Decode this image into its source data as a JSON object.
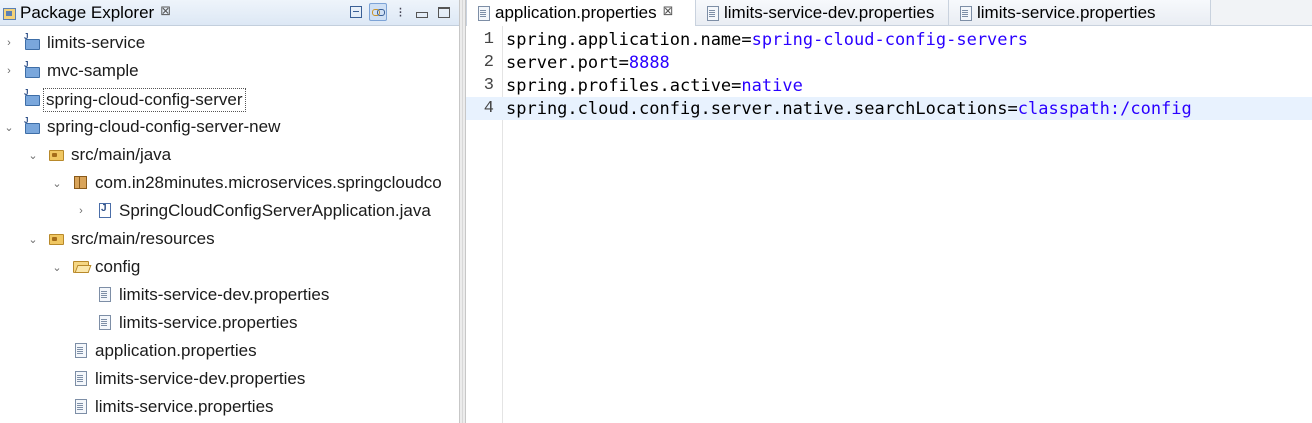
{
  "explorer": {
    "title": "Package Explorer",
    "close_glyph": "⊠",
    "toolbar": {
      "collapse_all": "collapse-all-icon",
      "link_editor": "link-with-editor-icon",
      "view_menu": "⁝",
      "minimize": "minimize-icon",
      "maximize": "maximize-icon"
    },
    "tree": [
      {
        "label": "limits-service",
        "depth": 0,
        "chevron": "›",
        "icon": "project"
      },
      {
        "label": "mvc-sample",
        "depth": 0,
        "chevron": "›",
        "icon": "project"
      },
      {
        "label": "spring-cloud-config-server",
        "depth": 0,
        "chevron": "",
        "icon": "project",
        "selected": true
      },
      {
        "label": "spring-cloud-config-server-new",
        "depth": 0,
        "chevron": "⌄",
        "icon": "project"
      },
      {
        "label": "src/main/java",
        "depth": 1,
        "chevron": "⌄",
        "icon": "srcfolder"
      },
      {
        "label": "com.in28minutes.microservices.springcloudco",
        "depth": 2,
        "chevron": "⌄",
        "icon": "package"
      },
      {
        "label": "SpringCloudConfigServerApplication.java",
        "depth": 3,
        "chevron": "›",
        "icon": "java"
      },
      {
        "label": "src/main/resources",
        "depth": 1,
        "chevron": "⌄",
        "icon": "srcfolder"
      },
      {
        "label": "config",
        "depth": 2,
        "chevron": "⌄",
        "icon": "folder"
      },
      {
        "label": "limits-service-dev.properties",
        "depth": 3,
        "chevron": "",
        "icon": "file"
      },
      {
        "label": "limits-service.properties",
        "depth": 3,
        "chevron": "",
        "icon": "file"
      },
      {
        "label": "application.properties",
        "depth": 2,
        "chevron": "",
        "icon": "file"
      },
      {
        "label": "limits-service-dev.properties",
        "depth": 2,
        "chevron": "",
        "icon": "file"
      },
      {
        "label": "limits-service.properties",
        "depth": 2,
        "chevron": "",
        "icon": "file"
      }
    ]
  },
  "editor": {
    "tabs": [
      {
        "title": "application.properties",
        "close": "⊠",
        "active": true
      },
      {
        "title": "limits-service-dev.properties",
        "active": false
      },
      {
        "title": "limits-service.properties",
        "active": false
      }
    ],
    "lines": [
      {
        "num": "1",
        "key": "spring.application.name",
        "eq": "=",
        "value": "spring-cloud-config-servers"
      },
      {
        "num": "2",
        "key": "server.port",
        "eq": "=",
        "value": "8888"
      },
      {
        "num": "3",
        "key": "spring.profiles.active",
        "eq": "=",
        "value": "native"
      },
      {
        "num": "4",
        "key": "spring.cloud.config.server.native.searchLocations",
        "eq": "=",
        "value": "classpath:/config",
        "current": true
      }
    ]
  },
  "colors": {
    "value_text": "#2a00ff",
    "current_line": "#e8f2fe",
    "tabbar": "#dde8f5"
  }
}
